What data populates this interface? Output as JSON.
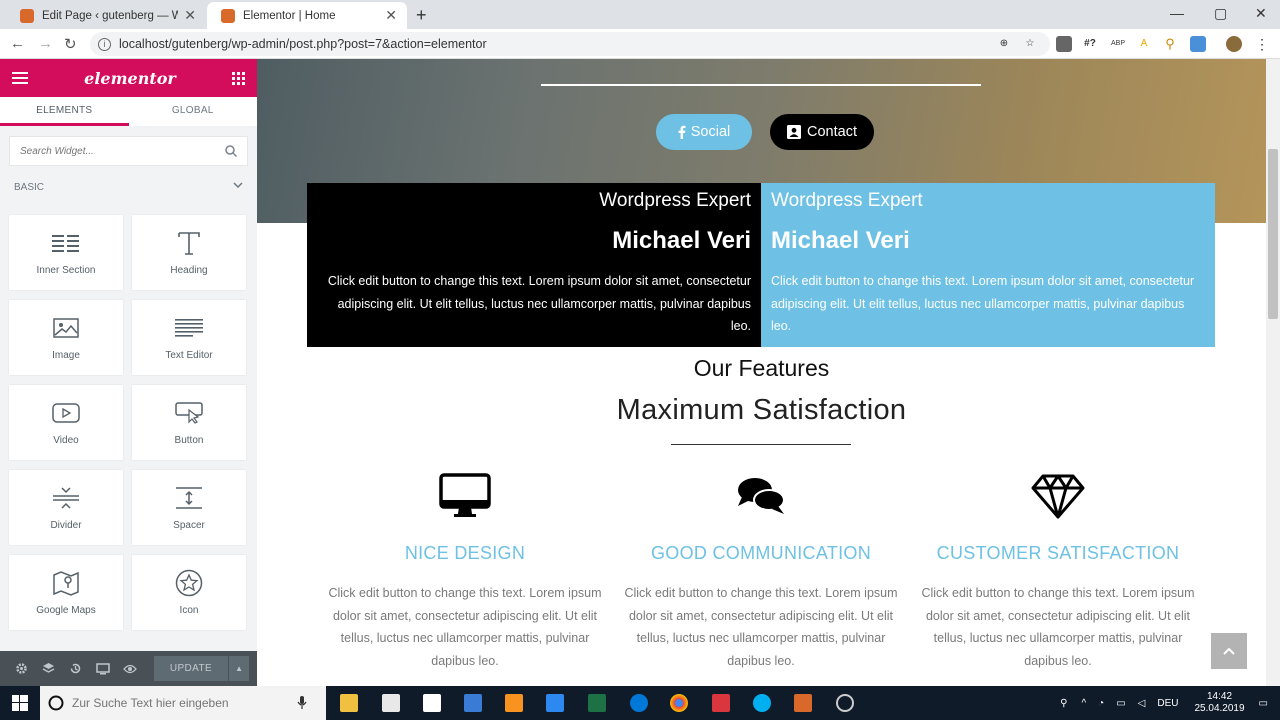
{
  "browser": {
    "tabs": [
      {
        "title": "Edit Page ‹ gutenberg — WordPr"
      },
      {
        "title": "Elementor | Home"
      }
    ],
    "address": "localhost/gutenberg/wp-admin/post.php?post=7&action=elementor",
    "extension_labels": {
      "hash": "#?",
      "abp": "ABP"
    }
  },
  "panel": {
    "logo": "elementor",
    "tabs": [
      {
        "label": "ELEMENTS"
      },
      {
        "label": "GLOBAL"
      }
    ],
    "search_placeholder": "Search Widget...",
    "category": "BASIC",
    "widgets": [
      {
        "label": "Inner Section",
        "icon": "inner-section-icon"
      },
      {
        "label": "Heading",
        "icon": "heading-icon"
      },
      {
        "label": "Image",
        "icon": "image-icon"
      },
      {
        "label": "Text Editor",
        "icon": "text-editor-icon"
      },
      {
        "label": "Video",
        "icon": "video-icon"
      },
      {
        "label": "Button",
        "icon": "button-icon"
      },
      {
        "label": "Divider",
        "icon": "divider-icon"
      },
      {
        "label": "Spacer",
        "icon": "spacer-icon"
      },
      {
        "label": "Google Maps",
        "icon": "google-maps-icon"
      },
      {
        "label": "Icon",
        "icon": "star-icon"
      }
    ],
    "update_label": "UPDATE"
  },
  "page": {
    "buttons": {
      "social": "Social",
      "contact": "Contact"
    },
    "cards": [
      {
        "role": "Wordpress Expert",
        "name": "Michael Veri",
        "text": "Click edit button to change this text. Lorem ipsum dolor sit amet, consectetur adipiscing elit. Ut elit tellus, luctus nec ullamcorper mattis, pulvinar dapibus leo."
      },
      {
        "role": "Wordpress Expert",
        "name": "Michael Veri",
        "text": "Click edit button to change this text. Lorem ipsum dolor sit amet, consectetur adipiscing elit. Ut elit tellus, luctus nec ullamcorper mattis, pulvinar dapibus leo."
      }
    ],
    "features_title": "Our Features",
    "features_subtitle": "Maximum Satisfaction",
    "features": [
      {
        "icon": "monitor-icon",
        "title": "NICE DESIGN",
        "text": "Click edit button to change this text. Lorem ipsum dolor sit amet, consectetur adipiscing elit. Ut elit tellus, luctus nec ullamcorper mattis, pulvinar dapibus leo."
      },
      {
        "icon": "chat-bubbles-icon",
        "title": "GOOD COMMUNICATION",
        "text": "Click edit button to change this text. Lorem ipsum dolor sit amet, consectetur adipiscing elit. Ut elit tellus, luctus nec ullamcorper mattis, pulvinar dapibus leo."
      },
      {
        "icon": "diamond-icon",
        "title": "CUSTOMER SATISFACTION",
        "text": "Click edit button to change this text. Lorem ipsum dolor sit amet, consectetur adipiscing elit. Ut elit tellus, luctus nec ullamcorper mattis, pulvinar dapibus leo."
      }
    ]
  },
  "taskbar": {
    "search_placeholder": "Zur Suche Text hier eingeben",
    "language": "DEU",
    "time": "14:42",
    "date": "25.04.2019"
  },
  "colors": {
    "elementor_pink": "#d30c5c",
    "accent_blue": "#6ec1e4",
    "panel_bg": "#f2f3f5"
  }
}
